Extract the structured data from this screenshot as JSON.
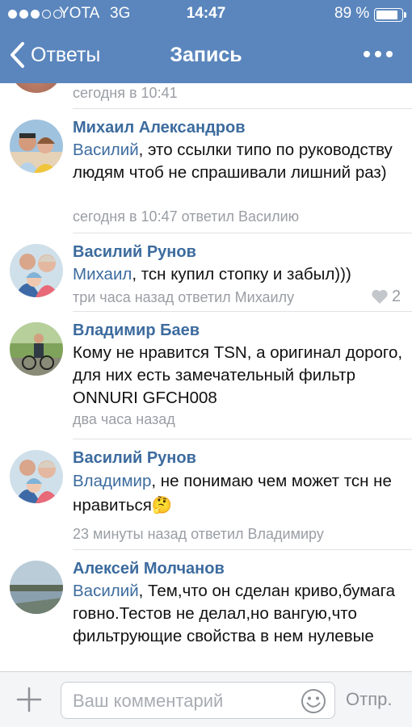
{
  "status_bar": {
    "signal_dots_filled": 3,
    "signal_dots_total": 5,
    "carrier": "YOTA",
    "network": "3G",
    "time": "14:47",
    "battery_percent": "89 %",
    "battery_level": 0.89
  },
  "nav": {
    "back_label": "Ответы",
    "title": "Запись",
    "icons": [
      "chevron-left-icon",
      "more-dots-icon"
    ]
  },
  "feed": {
    "previous_meta": "сегодня в 10:41",
    "comments": [
      {
        "author": "Михаил Александров",
        "reply_to": "Василий",
        "text": ", это ссылки типо по руководству людям чтоб не спрашивали лишний раз)",
        "meta": "сегодня в 10:47 ответил Василию"
      },
      {
        "author": "Василий Рунов",
        "reply_to": "Михаил",
        "text": ", тсн купил стопку и забыл)))",
        "meta": "три часа назад ответил Михаилу",
        "likes": "2"
      },
      {
        "author": "Владимир Баев",
        "reply_to": "",
        "text": "Кому не нравится TSN, а оригинал дорого, для них есть замечательный фильтр ONNURI GFCH008",
        "meta": "два часа назад"
      },
      {
        "author": "Василий Рунов",
        "reply_to": "Владимир",
        "text": ", не понимаю чем может тсн не нравиться🤔",
        "meta": "23 минуты назад ответил Владимиру"
      },
      {
        "author": "Алексей Молчанов",
        "reply_to": "Василий",
        "text": ", Тем,что он сделан криво,бумага говно.Тестов не делал,но вангую,что фильтрующие свойства в нем нулевые",
        "meta": ""
      }
    ]
  },
  "composer": {
    "placeholder": "Ваш комментарий",
    "value": "",
    "send_label": "Отпр.",
    "icons": [
      "plus-icon",
      "smiley-icon"
    ]
  },
  "colors": {
    "header": "#5b86bd",
    "link": "#3c6b9e",
    "meta": "#9a9ea4"
  }
}
